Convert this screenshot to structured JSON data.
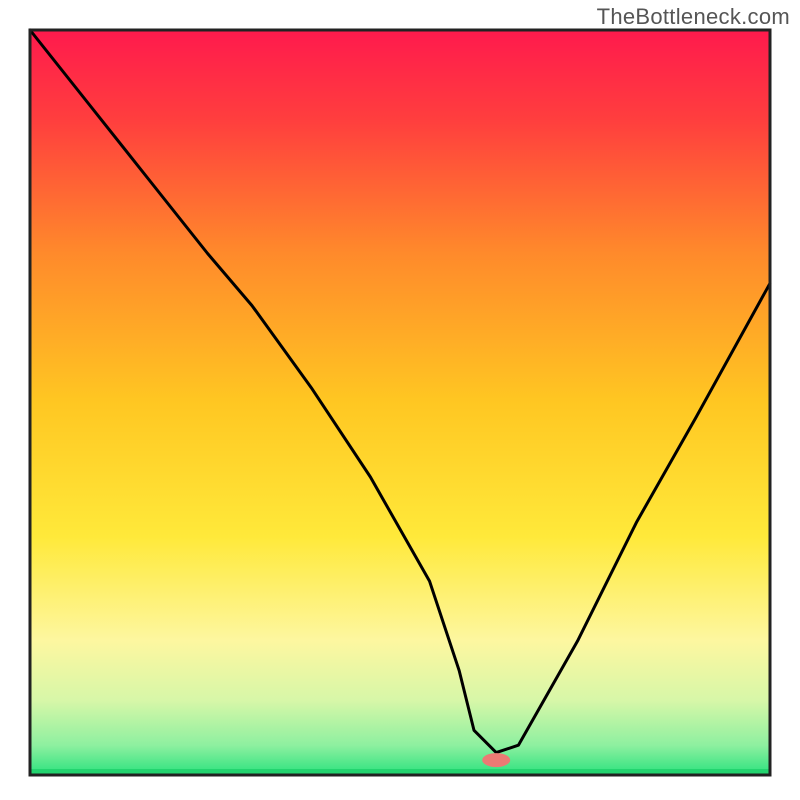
{
  "watermark": "TheBottleneck.com",
  "chart_data": {
    "type": "line",
    "title": "",
    "xlabel": "",
    "ylabel": "",
    "xlim": [
      0,
      100
    ],
    "ylim": [
      0,
      100
    ],
    "grid": false,
    "legend": false,
    "gradient_stops": [
      {
        "offset": 0.0,
        "color": "#ff1a4d"
      },
      {
        "offset": 0.12,
        "color": "#ff3e3e"
      },
      {
        "offset": 0.3,
        "color": "#ff8a2b"
      },
      {
        "offset": 0.5,
        "color": "#ffc722"
      },
      {
        "offset": 0.68,
        "color": "#ffe93a"
      },
      {
        "offset": 0.82,
        "color": "#fdf7a0"
      },
      {
        "offset": 0.9,
        "color": "#d7f7a8"
      },
      {
        "offset": 0.96,
        "color": "#8ef0a0"
      },
      {
        "offset": 1.0,
        "color": "#2be27e"
      }
    ],
    "series": [
      {
        "name": "bottleneck-curve",
        "x": [
          0,
          8,
          16,
          24,
          30,
          38,
          46,
          54,
          58,
          60,
          63,
          66,
          74,
          82,
          90,
          100
        ],
        "y": [
          100,
          90,
          80,
          70,
          63,
          52,
          40,
          26,
          14,
          6,
          3,
          4,
          18,
          34,
          48,
          66
        ]
      }
    ],
    "marker": {
      "name": "optimal-point",
      "x": 63,
      "y": 2,
      "color": "#ec7a74",
      "rx": 14,
      "ry": 7
    },
    "baseline_color": "#23d46f",
    "frame_color": "#222222"
  }
}
